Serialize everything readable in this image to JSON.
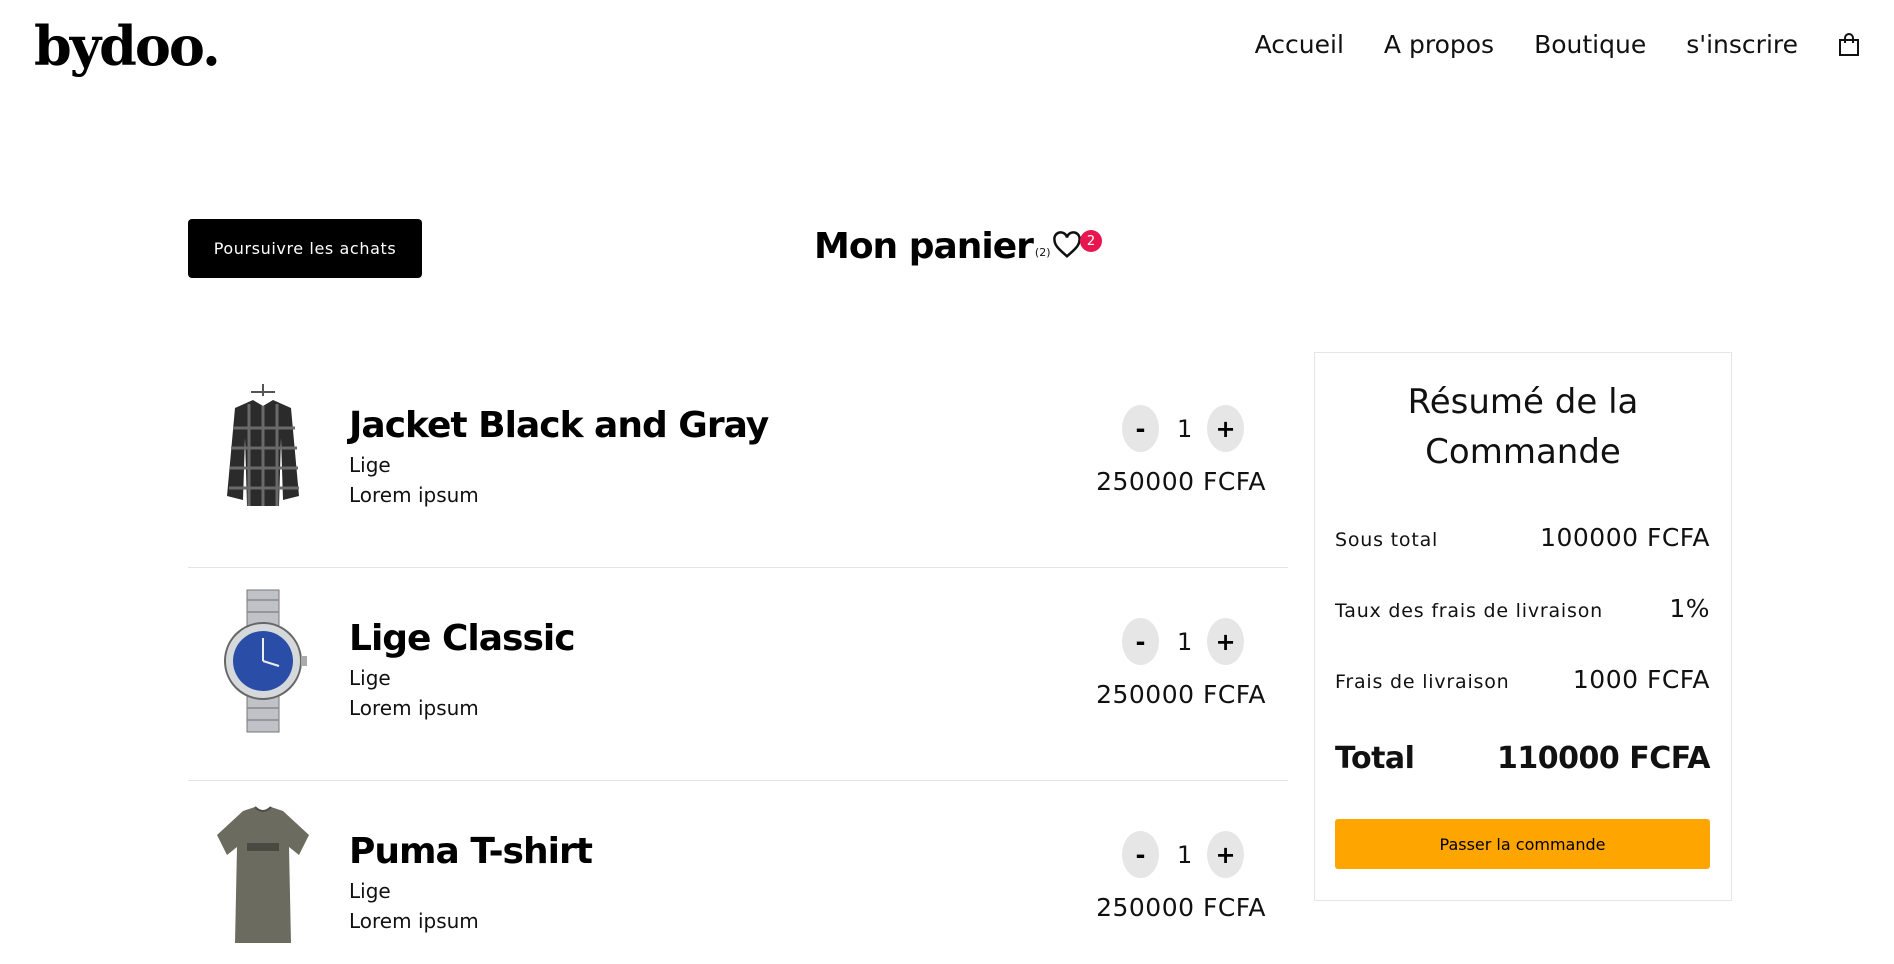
{
  "header": {
    "logo": "bydoo.",
    "nav": [
      "Accueil",
      "A propos",
      "Boutique",
      "s'inscrire"
    ],
    "cart_icon": "shopping-bag-icon"
  },
  "toolbar": {
    "continue_label": "Poursuivre les achats",
    "title": "Mon panier",
    "count": "(2)",
    "wishlist_icon": "heart-icon",
    "wishlist_badge": "2",
    "badge_color": "#e8154f"
  },
  "cart": {
    "items": [
      {
        "name": "Jacket Black and Gray",
        "brand": "Lige",
        "description": "Lorem ipsum",
        "quantity": "1",
        "price": "250000 FCFA",
        "minus": "-",
        "plus": "+",
        "image_icon": "jacket-image"
      },
      {
        "name": "Lige Classic",
        "brand": "Lige",
        "description": "Lorem ipsum",
        "quantity": "1",
        "price": "250000 FCFA",
        "minus": "-",
        "plus": "+",
        "image_icon": "watch-image"
      },
      {
        "name": "Puma T-shirt",
        "brand": "Lige",
        "description": "Lorem ipsum",
        "quantity": "1",
        "price": "250000 FCFA",
        "minus": "-",
        "plus": "+",
        "image_icon": "tshirt-image"
      }
    ]
  },
  "summary": {
    "title": "Résumé de la Commande",
    "subtotal_label": "Sous total",
    "subtotal_value": "100000 FCFA",
    "rate_label": "Taux des frais de livraison",
    "rate_value": "1%",
    "shipping_label": "Frais de livraison",
    "shipping_value": "1000 FCFA",
    "total_label": "Total",
    "total_value": "110000 FCFA",
    "order_button": "Passer la commande",
    "order_button_color": "#ffa500"
  }
}
